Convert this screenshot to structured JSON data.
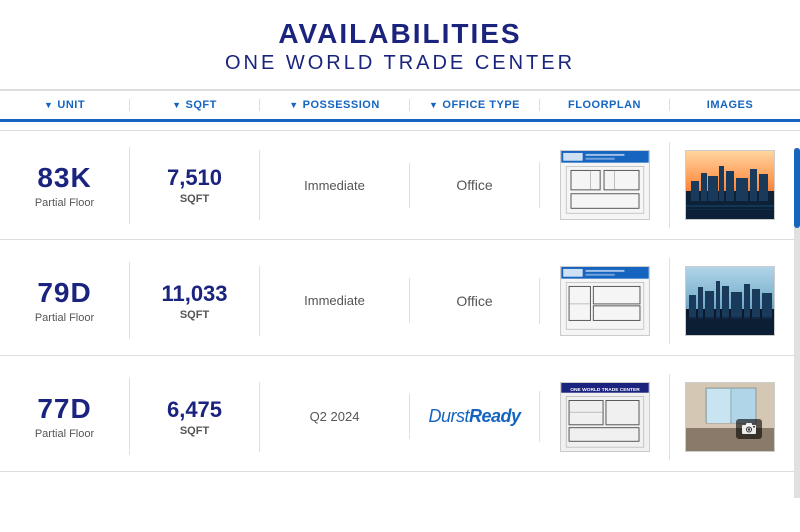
{
  "header": {
    "title": "AVAILABILITIES",
    "subtitle": "ONE WORLD TRADE CENTER"
  },
  "columns": [
    {
      "id": "unit",
      "label": "UNIT"
    },
    {
      "id": "sqft",
      "label": "SQFT"
    },
    {
      "id": "possession",
      "label": "POSSESSION"
    },
    {
      "id": "office_type",
      "label": "OFFICE TYPE"
    },
    {
      "id": "floorplan",
      "label": "FLOORPLAN"
    },
    {
      "id": "images",
      "label": "IMAGES"
    }
  ],
  "rows": [
    {
      "unit_id": "83K",
      "unit_label": "Partial Floor",
      "sqft_value": "7,510",
      "sqft_label": "SQFT",
      "possession": "Immediate",
      "office_type": "Office"
    },
    {
      "unit_id": "79D",
      "unit_label": "Partial Floor",
      "sqft_value": "11,033",
      "sqft_label": "SQFT",
      "possession": "Immediate",
      "office_type": "Office"
    },
    {
      "unit_id": "77D",
      "unit_label": "Partial Floor",
      "sqft_value": "6,475",
      "sqft_label": "SQFT",
      "possession": "Q2 2024",
      "office_type": "durst_ready"
    }
  ]
}
